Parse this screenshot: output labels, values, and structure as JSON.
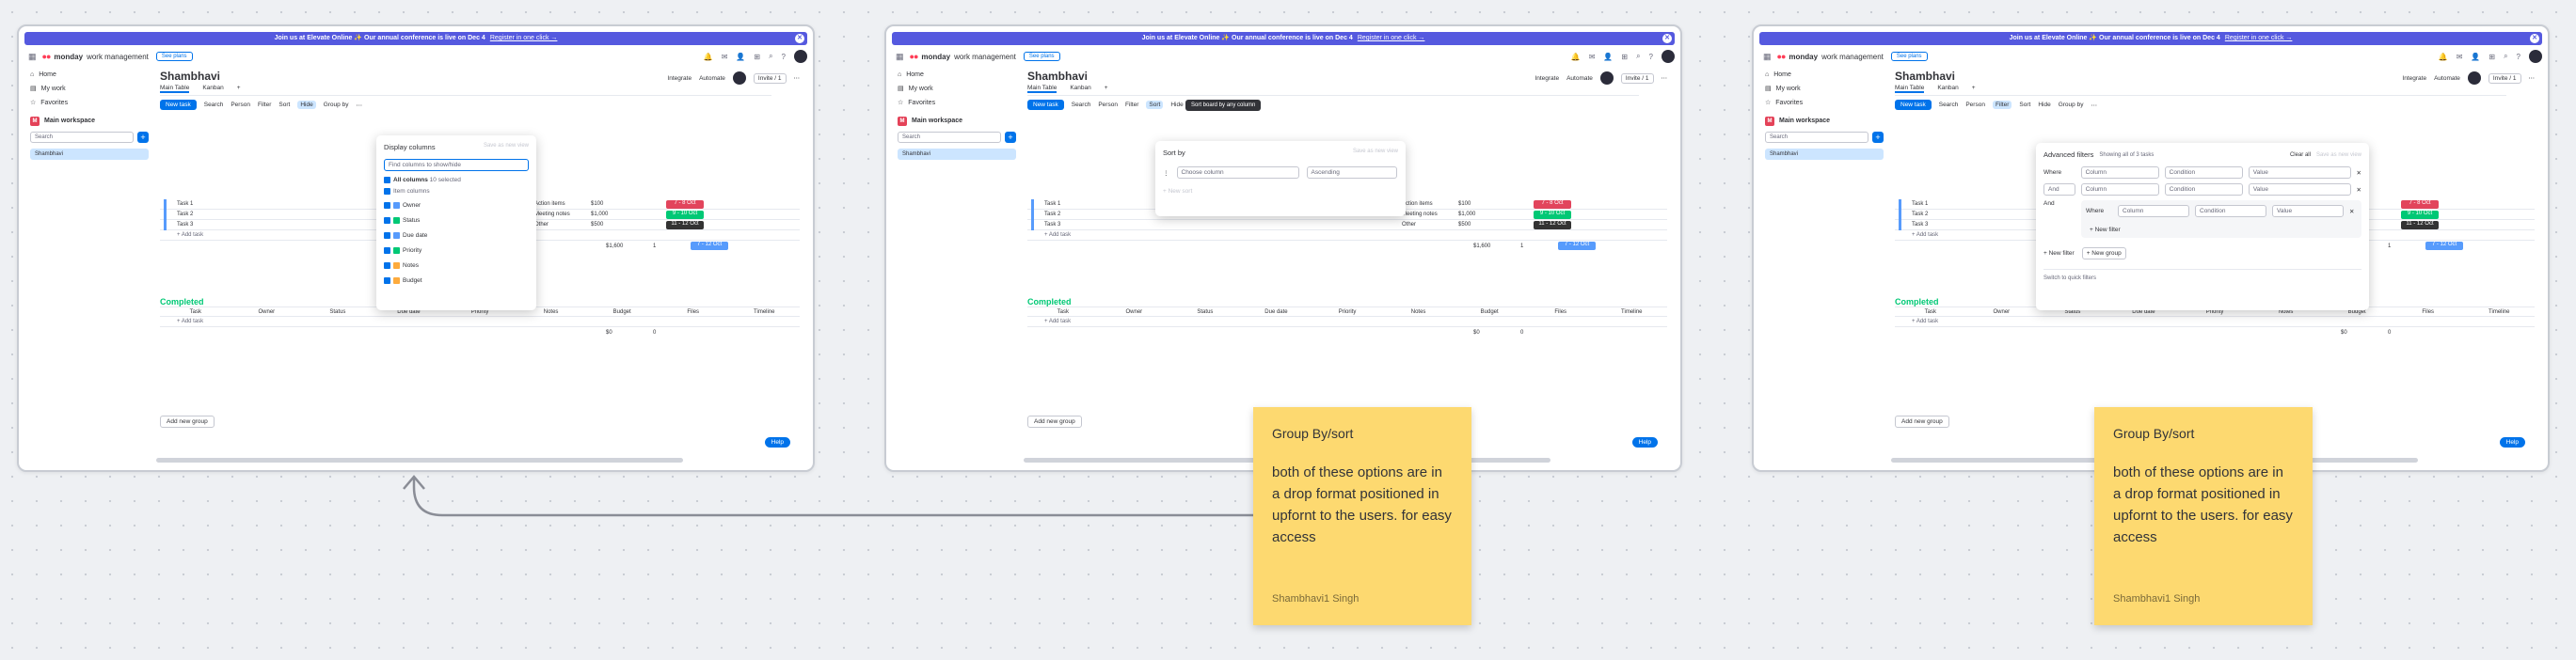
{
  "app": {
    "banner_text": "Join us at Elevate Online ✨ Our annual conference is live on Dec 4",
    "banner_link": "Register in one click →",
    "logo_bold": "monday",
    "logo_rest": "work management",
    "see_plans": "See plans"
  },
  "sidebar": {
    "home": "Home",
    "my_work": "My work",
    "favorites": "Favorites",
    "workspace": "Main workspace",
    "workspace_badge": "M",
    "search_placeholder": "Search",
    "board": "Shambhavi"
  },
  "board": {
    "title": "Shambhavi",
    "integrate": "Integrate",
    "automate": "Automate",
    "invite": "Invite / 1",
    "tabs": [
      "Main Table",
      "Kanban"
    ],
    "toolbar": {
      "new_task": "New task",
      "search": "Search",
      "person": "Person",
      "filter": "Filter",
      "sort": "Sort",
      "hide": "Hide",
      "group_by": "Group by"
    },
    "tasks": [
      "Task 1",
      "Task 2",
      "Task 3"
    ],
    "notes": [
      "Action items",
      "Meeting notes",
      "Other"
    ],
    "budgets": [
      "$100",
      "$1,000",
      "$500"
    ],
    "budget_sum": "$1,600",
    "budget_sum_label": "sum",
    "files_sum": "1",
    "files_sum_label": "files",
    "timelines": [
      "7 - 8 Oct",
      "9 - 10 Oct",
      "11 - 12 Oct"
    ],
    "timeline_sum": "7 - 12 Oct",
    "add_task": "+ Add task",
    "completed_title": "Completed",
    "columns": [
      "Task",
      "Owner",
      "Status",
      "Due date",
      "Priority",
      "Notes",
      "Budget",
      "Files",
      "Timeline"
    ],
    "completed_budget": "$0",
    "completed_files": "0",
    "add_new_group": "Add new group",
    "help": "Help"
  },
  "hide_popup": {
    "title": "Display columns",
    "save_view": "Save as new view",
    "search_placeholder": "Find columns to show/hide",
    "all_columns": "All columns",
    "selected": "10 selected",
    "item_columns": "Item columns",
    "columns": [
      "Owner",
      "Status",
      "Due date",
      "Priority",
      "Notes",
      "Budget"
    ]
  },
  "sort_popup": {
    "tooltip": "Sort board by any column",
    "title": "Sort by",
    "save_view": "Save as new view",
    "choose_column": "Choose column",
    "ascending": "Ascending",
    "new_sort": "+ New sort"
  },
  "filter_popup": {
    "title": "Advanced filters",
    "showing": "Showing all of 3 tasks",
    "clear_all": "Clear all",
    "save_view": "Save as new view",
    "where": "Where",
    "and": "And",
    "column": "Column",
    "condition": "Condition",
    "value": "Value",
    "new_filter": "+ New filter",
    "new_group": "+ New group",
    "quick_filters": "Switch to quick filters"
  },
  "stickies": [
    {
      "title": "Group By/sort",
      "body": "both of these options are in a drop format positioned in upfornt to the users. for easy access",
      "author": "Shambhavi1 Singh"
    },
    {
      "title": "Group By/sort",
      "body": "both of these options are in a drop format positioned in upfornt to the users. for easy access",
      "author": "Shambhavi1 Singh"
    }
  ],
  "colors": {
    "accent": "#0073ea",
    "banner": "#5559df",
    "done": "#00c875",
    "working": "#fdab3d",
    "stuck": "#e2445c",
    "sticky": "#fdd970"
  }
}
